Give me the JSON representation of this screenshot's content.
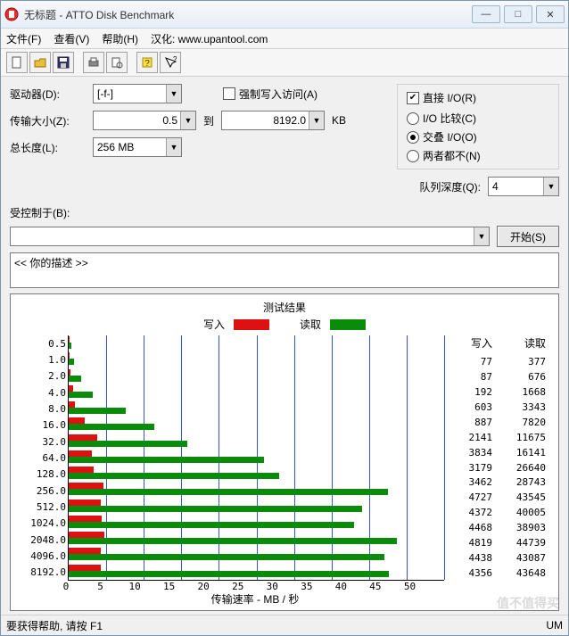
{
  "window": {
    "title": "无标题 - ATTO Disk Benchmark"
  },
  "menu": {
    "file": "文件(F)",
    "view": "查看(V)",
    "help": "帮助(H)",
    "sinicize": "汉化: www.upantool.com"
  },
  "form": {
    "drive_label": "驱动器(D):",
    "drive_value": "[-f-]",
    "force_write_label": "强制写入访问(A)",
    "direct_io_label": "直接 I/O(R)",
    "transfer_size_label": "传输大小(Z):",
    "transfer_from": "0.5",
    "transfer_to_label": "到",
    "transfer_to": "8192.0",
    "transfer_unit": "KB",
    "io_compare_label": "I/O 比较(C)",
    "io_overlap_label": "交叠 I/O(O)",
    "io_neither_label": "两者都不(N)",
    "total_length_label": "总长度(L):",
    "total_length_value": "256 MB",
    "queue_depth_label": "队列深度(Q):",
    "queue_depth_value": "4",
    "controlled_by_label": "受控制于(B):",
    "controlled_by_value": "",
    "start_label": "开始(S)",
    "description": "<<  你的描述   >>"
  },
  "results": {
    "title": "测试结果",
    "write_legend": "写入",
    "read_legend": "读取",
    "write_hdr": "写入",
    "read_hdr": "读取",
    "xaxis_label": "传输速率 - MB / 秒"
  },
  "status": {
    "help": "要获得帮助, 请按 F1",
    "right": "UM"
  },
  "watermark": "值不值得买",
  "chart_data": {
    "type": "bar",
    "orientation": "horizontal",
    "xlabel": "传输速率 - MB / 秒",
    "xlim": [
      0,
      50
    ],
    "xticks": [
      0,
      5,
      10,
      15,
      20,
      25,
      30,
      35,
      40,
      45,
      50
    ],
    "categories": [
      "0.5",
      "1.0",
      "2.0",
      "4.0",
      "8.0",
      "16.0",
      "32.0",
      "64.0",
      "128.0",
      "256.0",
      "512.0",
      "1024.0",
      "2048.0",
      "4096.0",
      "8192.0"
    ],
    "series": [
      {
        "name": "写入",
        "color": "#d11",
        "values_kb": [
          77,
          87,
          192,
          603,
          887,
          2141,
          3834,
          3179,
          3462,
          4727,
          4372,
          4468,
          4819,
          4438,
          4356
        ]
      },
      {
        "name": "读取",
        "color": "#0a8c0a",
        "values_kb": [
          377,
          676,
          1668,
          3343,
          7820,
          11675,
          16141,
          26640,
          28743,
          43545,
          40005,
          38903,
          44739,
          43087,
          43648
        ]
      }
    ],
    "note": "values_kb are KB/s as displayed in the right-hand columns; bars plot MB/s = values_kb/1024"
  }
}
